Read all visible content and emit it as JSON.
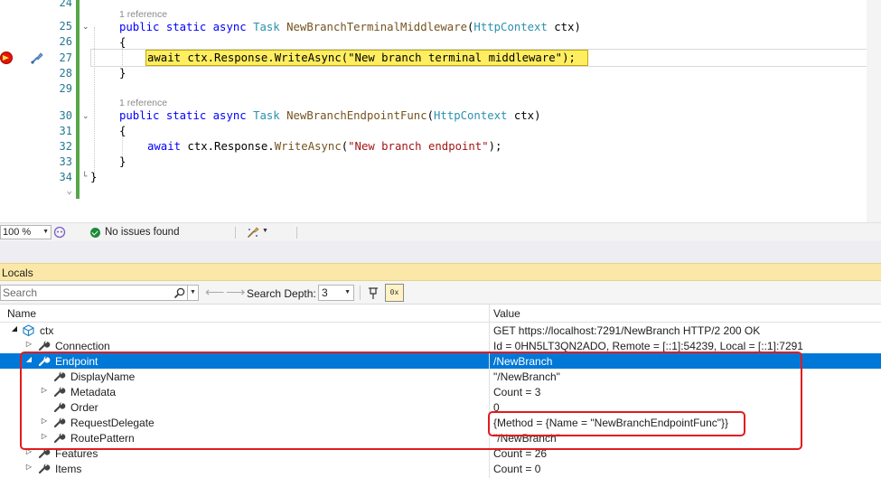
{
  "editor": {
    "line_numbers": [
      "24",
      "25",
      "26",
      "27",
      "28",
      "29",
      "30",
      "31",
      "32",
      "33",
      "34"
    ],
    "ellipsis": "⌄",
    "references": [
      "1 reference",
      "1 reference"
    ],
    "code": {
      "l25": {
        "kw1": "public",
        "kw2": "static",
        "kw3": "async",
        "type": "Task",
        "method": "NewBranchTerminalMiddleware",
        "open": "(",
        "ptype": "HttpContext",
        "pname": " ctx)"
      },
      "l26": "{",
      "l27": {
        "kw": "await",
        "mid": " ctx.Response.",
        "method": "WriteAsync",
        "open": "(",
        "str": "\"New branch terminal middleware\"",
        "close": ");"
      },
      "l28": "}",
      "l30": {
        "kw1": "public",
        "kw2": "static",
        "kw3": "async",
        "type": "Task",
        "method": "NewBranchEndpointFunc",
        "open": "(",
        "ptype": "HttpContext",
        "pname": " ctx)"
      },
      "l31": "{",
      "l32": {
        "kw": "await",
        "mid": " ctx.Response.",
        "method": "WriteAsync",
        "open": "(",
        "str": "\"New branch endpoint\"",
        "close": ");"
      },
      "l33": "}",
      "l34": "}"
    }
  },
  "status": {
    "zoom": "100 %",
    "issues": "No issues found"
  },
  "locals": {
    "title": "Locals",
    "search_placeholder": "Search",
    "search_depth_label": "Search Depth:",
    "search_depth_value": "3",
    "hex_label": "0x",
    "columns": {
      "name": "Name",
      "value": "Value"
    },
    "rows": [
      {
        "name": "ctx",
        "value": "GET https://localhost:7291/NewBranch HTTP/2 200 OK"
      },
      {
        "name": "Connection",
        "value": "Id = 0HN5LT3QN2ADO, Remote = [::1]:54239, Local = [::1]:7291"
      },
      {
        "name": "Endpoint",
        "value": "/NewBranch"
      },
      {
        "name": "DisplayName",
        "value": "\"/NewBranch\""
      },
      {
        "name": "Metadata",
        "value": "Count = 3"
      },
      {
        "name": "Order",
        "value": "0"
      },
      {
        "name": "RequestDelegate",
        "value": "{Method = {Name = \"NewBranchEndpointFunc\"}}"
      },
      {
        "name": "RoutePattern",
        "value": "\"/NewBranch\""
      },
      {
        "name": "Features",
        "value": "Count = 26"
      },
      {
        "name": "Items",
        "value": "Count = 0"
      }
    ]
  },
  "colors": {
    "selection": "#0078d7",
    "annotation_red": "#e31b1b",
    "current_statement": "#ffee62",
    "change_bar": "#57a64a"
  },
  "icons": {
    "breakpoint": "breakpoint-current-statement-icon",
    "brush": "paintbrush-icon",
    "ok": "check-circle-icon",
    "wrench": "wrench-property-icon",
    "variable": "variable-icon"
  }
}
